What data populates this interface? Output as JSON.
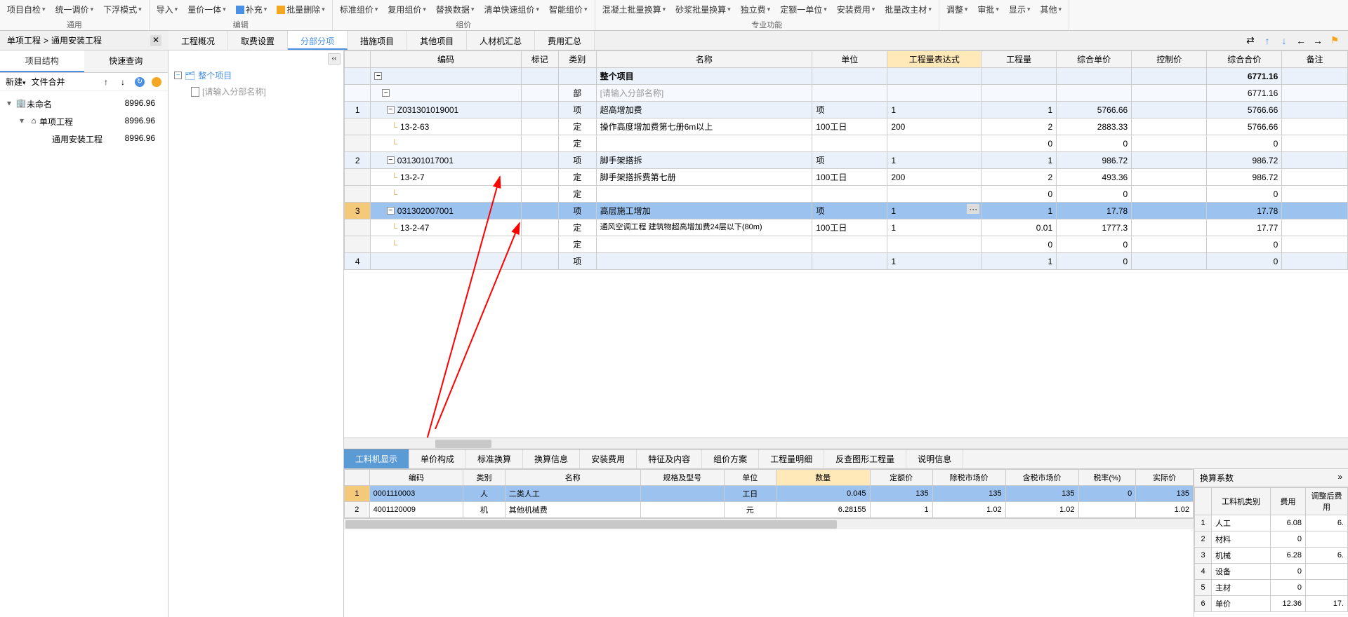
{
  "toolbar": {
    "groups": [
      {
        "label": "通用",
        "items": [
          "项目自检",
          "统一调价",
          "下浮模式"
        ]
      },
      {
        "label": "编辑",
        "items": [
          "导入",
          "量价一体",
          "补充",
          "批量删除"
        ]
      },
      {
        "label": "组价",
        "items": [
          "标准组价",
          "复用组价",
          "替换数据",
          "清单快速组价",
          "智能组价"
        ]
      },
      {
        "label": "专业功能",
        "items": [
          "混凝土批量换算",
          "砂浆批量换算",
          "独立费",
          "定额一单位",
          "安装费用",
          "批量改主材"
        ]
      },
      {
        "label": "",
        "items": [
          "调整",
          "审批",
          "显示",
          "其他"
        ]
      }
    ]
  },
  "breadcrumb": {
    "a": "单项工程",
    "sep": ">",
    "b": "通用安装工程"
  },
  "tabsA": [
    "工程概况",
    "取费设置",
    "分部分项",
    "措施项目",
    "其他项目",
    "人材机汇总",
    "费用汇总"
  ],
  "tabsA_active": 2,
  "left": {
    "tabs": [
      "项目结构",
      "快速查询"
    ],
    "bar": {
      "new": "新建",
      "merge": "文件合并"
    },
    "tree": [
      {
        "d": 0,
        "ico": "🏢",
        "name": "未命名",
        "val": "8996.96",
        "exp": "▾"
      },
      {
        "d": 1,
        "ico": "⌂",
        "name": "单项工程",
        "val": "8996.96",
        "exp": "▾"
      },
      {
        "d": 2,
        "ico": "",
        "name": "通用安装工程",
        "val": "8996.96",
        "exp": ""
      }
    ]
  },
  "mid": {
    "root": "整个项目",
    "child_ph": "[请输入分部名称]"
  },
  "grid": {
    "cols": [
      "",
      "编码",
      "标记",
      "类别",
      "名称",
      "单位",
      "工程量表达式",
      "工程量",
      "综合单价",
      "控制价",
      "综合合价",
      "备注"
    ],
    "hl_col": 6,
    "rows": [
      {
        "t": "proj",
        "rn": "",
        "code_box": "-",
        "code": "",
        "cat": "",
        "name": "整个项目",
        "unit": "",
        "expr": "",
        "qty": "",
        "up": "",
        "ctrl": "",
        "tot": "6771.16"
      },
      {
        "t": "sec",
        "rn": "",
        "code_box": "-",
        "code": "",
        "cat": "部",
        "name_ph": "[请输入分部名称]",
        "unit": "",
        "expr": "",
        "qty": "",
        "up": "",
        "ctrl": "",
        "tot": "6771.16"
      },
      {
        "t": "item",
        "rn": "1",
        "code_box": "-",
        "code": "Z031301019001",
        "cat": "项",
        "name": "超高增加费",
        "unit": "项",
        "expr": "1",
        "qty": "1",
        "up": "5766.66",
        "ctrl": "",
        "tot": "5766.66"
      },
      {
        "t": "norm",
        "rn": "",
        "code": "13-2-63",
        "cat": "定",
        "name": "操作高度增加费第七册6m以上",
        "unit": "100工日",
        "expr": "200",
        "qty": "2",
        "up": "2883.33",
        "ctrl": "",
        "tot": "5766.66"
      },
      {
        "t": "norm",
        "rn": "",
        "code": "",
        "cat": "定",
        "name": "",
        "unit": "",
        "expr": "",
        "qty": "0",
        "up": "0",
        "ctrl": "",
        "tot": "0"
      },
      {
        "t": "item",
        "rn": "2",
        "code_box": "-",
        "code": "031301017001",
        "cat": "项",
        "name": "脚手架搭拆",
        "unit": "项",
        "expr": "1",
        "qty": "1",
        "up": "986.72",
        "ctrl": "",
        "tot": "986.72"
      },
      {
        "t": "norm",
        "rn": "",
        "code": "13-2-7",
        "cat": "定",
        "name": "脚手架搭拆费第七册",
        "unit": "100工日",
        "expr": "200",
        "qty": "2",
        "up": "493.36",
        "ctrl": "",
        "tot": "986.72"
      },
      {
        "t": "norm",
        "rn": "",
        "code": "",
        "cat": "定",
        "name": "",
        "unit": "",
        "expr": "",
        "qty": "0",
        "up": "0",
        "ctrl": "",
        "tot": "0"
      },
      {
        "t": "sel",
        "rn": "3",
        "code_box": "-",
        "code": "031302007001",
        "cat": "项",
        "name": "高层施工增加",
        "unit": "项",
        "expr": "1",
        "expr_btn": "···",
        "qty": "1",
        "up": "17.78",
        "ctrl": "",
        "tot": "17.78"
      },
      {
        "t": "norm",
        "rn": "",
        "code": "13-2-47",
        "cat": "定",
        "name": "通风空调工程 建筑物超高增加费24层以下(80m)",
        "unit": "100工日",
        "expr": "1",
        "qty": "0.01",
        "up": "1777.3",
        "ctrl": "",
        "tot": "17.77"
      },
      {
        "t": "norm",
        "rn": "",
        "code": "",
        "cat": "定",
        "name": "",
        "unit": "",
        "expr": "",
        "qty": "0",
        "up": "0",
        "ctrl": "",
        "tot": "0"
      },
      {
        "t": "item",
        "rn": "4",
        "code_box": "",
        "code": "",
        "cat": "项",
        "name": "",
        "unit": "",
        "expr": "1",
        "qty": "1",
        "up": "0",
        "ctrl": "",
        "tot": "0"
      }
    ]
  },
  "btabs": [
    "工料机显示",
    "单价构成",
    "标准换算",
    "换算信息",
    "安装费用",
    "特征及内容",
    "组价方案",
    "工程量明细",
    "反查图形工程量",
    "说明信息"
  ],
  "btabs_active": 0,
  "mat": {
    "cols": [
      "",
      "编码",
      "类别",
      "名称",
      "规格及型号",
      "单位",
      "数量",
      "定额价",
      "除税市场价",
      "含税市场价",
      "税率(%)",
      "实际价"
    ],
    "hl_col": 6,
    "rows": [
      {
        "rn": "1",
        "code": "0001110003",
        "cat": "人",
        "name": "二类人工",
        "spec": "",
        "unit": "工日",
        "qty": "0.045",
        "dp": "135",
        "mp": "135",
        "tp": "135",
        "tax": "0",
        "ap": "135",
        "sel": true
      },
      {
        "rn": "2",
        "code": "4001120009",
        "cat": "机",
        "name": "其他机械费",
        "spec": "",
        "unit": "元",
        "qty": "6.28155",
        "dp": "1",
        "mp": "1.02",
        "tp": "1.02",
        "tax": "",
        "ap": "1.02"
      }
    ]
  },
  "coef": {
    "title": "换算系数",
    "cols": [
      "",
      "工料机类别",
      "费用",
      "调整后费用"
    ],
    "rows": [
      {
        "rn": "1",
        "name": "人工",
        "fee": "6.08",
        "adj": "6."
      },
      {
        "rn": "2",
        "name": "材料",
        "fee": "0",
        "adj": ""
      },
      {
        "rn": "3",
        "name": "机械",
        "fee": "6.28",
        "adj": "6."
      },
      {
        "rn": "4",
        "name": "设备",
        "fee": "0",
        "adj": ""
      },
      {
        "rn": "5",
        "name": "主材",
        "fee": "0",
        "adj": ""
      },
      {
        "rn": "6",
        "name": "单价",
        "fee": "12.36",
        "adj": "17."
      }
    ]
  }
}
